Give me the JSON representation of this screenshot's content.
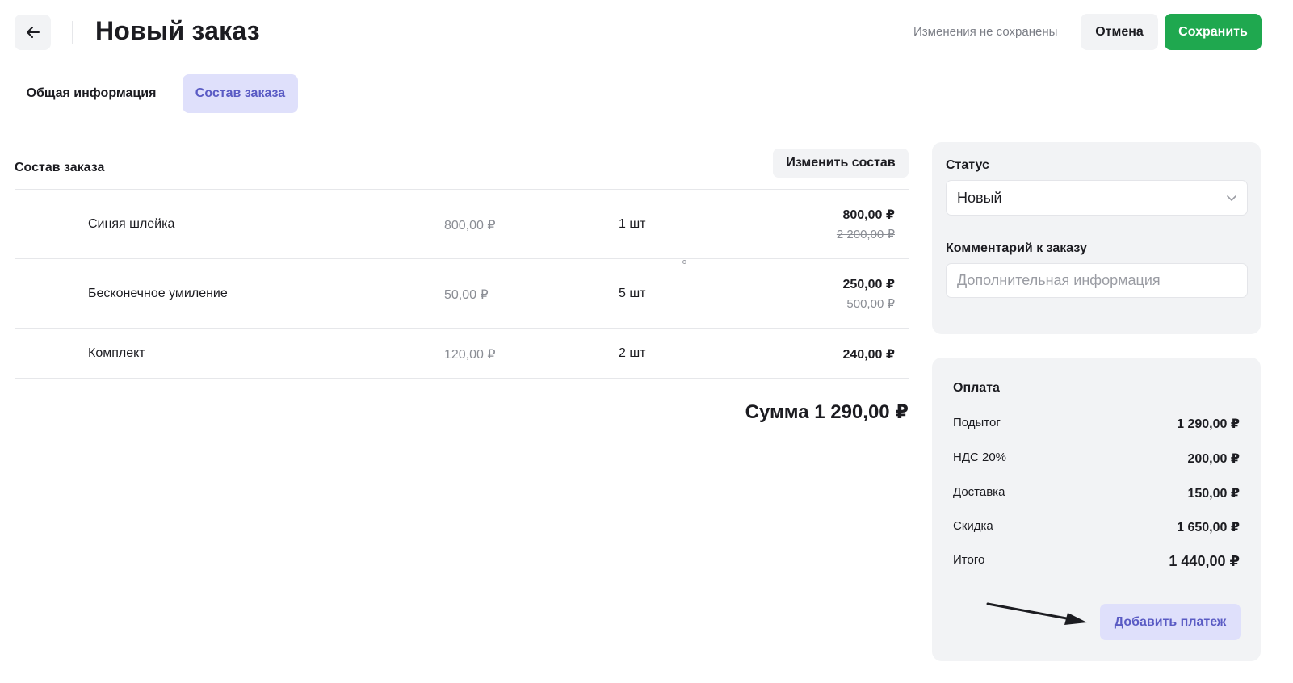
{
  "header": {
    "title": "Новый заказ",
    "unsaved_text": "Изменения не сохранены",
    "cancel_label": "Отмена",
    "save_label": "Сохранить",
    "back_icon": "arrow-left-icon"
  },
  "tabs": [
    {
      "label": "Общая информация",
      "active": false
    },
    {
      "label": "Состав заказа",
      "active": true
    }
  ],
  "composition": {
    "title": "Состав заказа",
    "edit_label": "Изменить состав",
    "items": [
      {
        "name": "Синяя шлейка",
        "price": "800,00 ₽",
        "qty": "1 шт",
        "total": "800,00 ₽",
        "old_total": "2 200,00 ₽"
      },
      {
        "name": "Бесконечное умиление",
        "price": "50,00 ₽",
        "qty": "5 шт",
        "total": "250,00 ₽",
        "old_total": "500,00 ₽"
      },
      {
        "name": "Комплект",
        "price": "120,00 ₽",
        "qty": "2 шт",
        "total": "240,00 ₽"
      }
    ],
    "sum_text": "Сумма 1 290,00 ₽"
  },
  "status": {
    "label": "Статус",
    "value": "Новый",
    "comment_label": "Комментарий к заказу",
    "comment_placeholder": "Дополнительная информация",
    "comment_value": ""
  },
  "payment": {
    "title": "Оплата",
    "rows": [
      {
        "label": "Подытог",
        "value": "1 290,00 ₽"
      },
      {
        "label": "НДС 20%",
        "value": "200,00 ₽"
      },
      {
        "label": "Доставка",
        "value": "150,00 ₽"
      },
      {
        "label": "Скидка",
        "value": "1 650,00 ₽"
      },
      {
        "label": "Итого",
        "value": "1 440,00 ₽"
      }
    ],
    "add_payment_label": "Добавить платеж"
  },
  "colors": {
    "accent": "#5a5bc4",
    "accent_bg": "#dfe0fb",
    "primary": "#1fa84f",
    "surface": "#f2f3f5"
  }
}
